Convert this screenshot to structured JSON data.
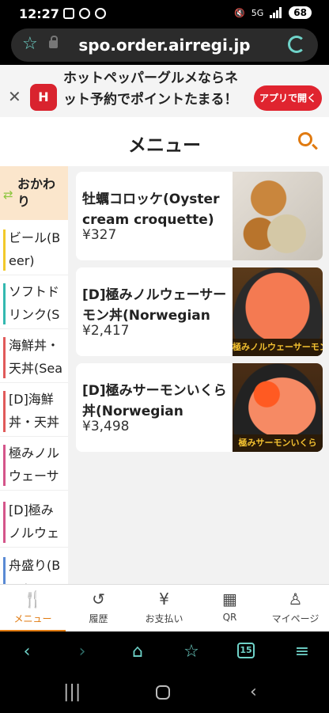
{
  "status": {
    "time": "12:27",
    "network": "5G",
    "battery": "68"
  },
  "browser": {
    "url": "spo.order.airregi.jp",
    "tabs_count": "15"
  },
  "banner": {
    "logo": "H",
    "text": "ホットペッパーグルメならネット予約でポイントたまる！",
    "button": "アプリで開く"
  },
  "header": {
    "title": "メニュー"
  },
  "sidebar": {
    "active": {
      "label": "おかわり"
    },
    "items": [
      {
        "label": "ビール(Beer)",
        "color": "#f2c92a"
      },
      {
        "label": "ソフトドリンク(Soft drinks)",
        "color": "#34b8b0"
      },
      {
        "label": "海鮮丼・天丼(Seafood bowls)",
        "color": "#e05a5a"
      },
      {
        "label": "[D]海鮮丼・天丼(Seafood)",
        "color": "#e05a5a"
      },
      {
        "label": "極みノルウェーサーモン",
        "color": "#d4558a"
      },
      {
        "label": "[D]極みノルウェー",
        "color": "#d4558a"
      },
      {
        "label": "舟盛り(Boat assortment)",
        "color": "#5a8ad4"
      }
    ]
  },
  "items": [
    {
      "name": "牡蠣コロッケ(Oyster cream croquette)",
      "price": "¥327",
      "image": "oyster-croquette-photo"
    },
    {
      "name": "[D]極みノルウェーサーモン丼(Norwegian salmon bowl)",
      "price": "¥2,417",
      "image": "salmon-bowl-photo",
      "image_text": "極みノルウェーサーモン"
    },
    {
      "name": "[D]極みサーモンいくら丼(Norwegian salmon ikura)",
      "price": "¥3,498",
      "image": "salmon-ikura-bowl-photo",
      "image_text": "極みサーモンいくら"
    }
  ],
  "tabbar": [
    {
      "label": "メニュー",
      "icon": "fork-knife-icon",
      "active": true
    },
    {
      "label": "履歴",
      "icon": "history-icon",
      "active": false
    },
    {
      "label": "お支払い",
      "icon": "yen-icon",
      "active": false
    },
    {
      "label": "QR",
      "icon": "qr-icon",
      "active": false
    },
    {
      "label": "マイページ",
      "icon": "person-icon",
      "active": false
    }
  ],
  "colors": {
    "accent": "#e07a10",
    "banner_button": "#e0242f",
    "browser_accent": "#6fd3c9"
  }
}
